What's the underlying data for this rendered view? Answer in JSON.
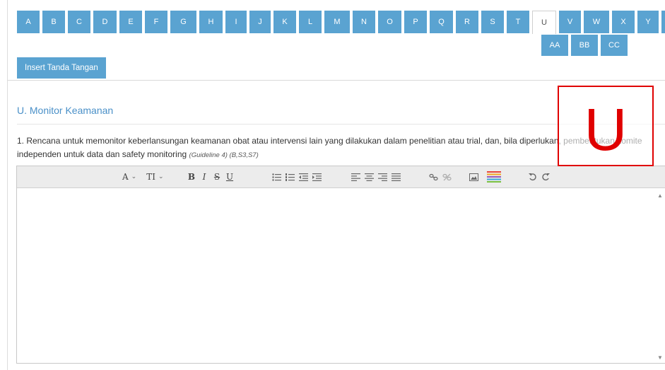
{
  "tabs_row1": [
    "A",
    "B",
    "C",
    "D",
    "E",
    "F",
    "G",
    "H",
    "I",
    "J",
    "K",
    "L",
    "M",
    "N",
    "O",
    "P",
    "Q",
    "R",
    "S",
    "T",
    "U",
    "V",
    "W",
    "X",
    "Y",
    "Z"
  ],
  "tabs_row2": [
    "AA",
    "BB",
    "CC"
  ],
  "active_tab": "U",
  "insert_button": "Insert Tanda Tangan",
  "section_title": "U. Monitor Keamanan",
  "question": {
    "text": "1. Rencana untuk memonitor keberlansungan keamanan obat atau intervensi lain yang dilakukan dalam penelitian atau trial, dan, bila diperlukan, pembentukan komite independen untuk data dan safety monitoring",
    "guideline": "(Guideline 4) (B,S3,S7)"
  },
  "toolbar": {
    "font_label": "A",
    "size_label": "TI",
    "bold": "B",
    "italic": "I",
    "strike": "S",
    "underline": "U"
  },
  "overlay_letter": "U",
  "colors": {
    "tab_bg": "#5aa3d1",
    "title": "#4a90c8",
    "overlay": "#e00000"
  }
}
